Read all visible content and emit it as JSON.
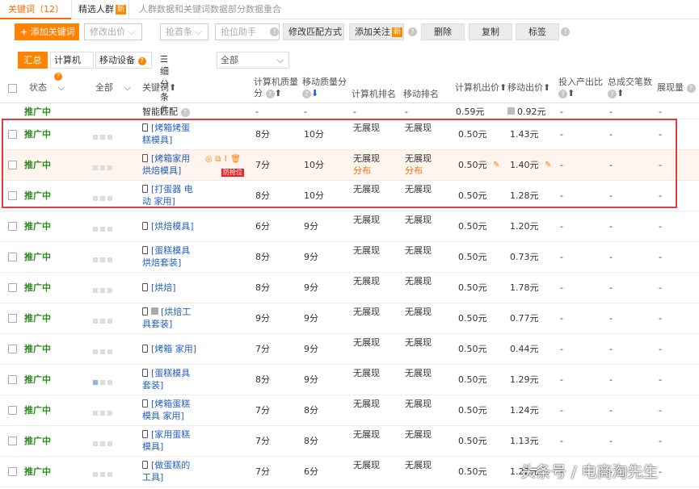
{
  "tabs": {
    "keyword_tab": "关键词",
    "keyword_count": "（12）",
    "crowd_tab": "精选人群",
    "new_badge": "新",
    "note": "人群数据和关键词数据部分数据重合"
  },
  "toolbar": {
    "add_keyword": "添加关键词",
    "change_bid": "修改出价",
    "grab_first": "抢首条",
    "rank_helper": "抢位助手",
    "change_match": "修改匹配方式",
    "add_follow": "添加关注",
    "delete": "删除",
    "copy": "复制",
    "tag": "标签"
  },
  "filters": {
    "summary": "汇总",
    "computer": "计算机",
    "mobile": "移动设备",
    "detail_label": "细分条件:",
    "detail_value": "全部"
  },
  "headers": {
    "status": "状态",
    "all": "全部",
    "keyword": "关键词",
    "pc_quality": "计算机质量分",
    "mobile_quality": "移动质量分",
    "pc_rank": "计算机排名",
    "mobile_rank": "移动排名",
    "pc_bid": "计算机出价",
    "mobile_bid": "移动出价",
    "roi": "投入产出比",
    "total_orders": "总成交笔数",
    "impressions": "展现量"
  },
  "smart_match": {
    "status": "推广中",
    "label": "智能匹配",
    "pc_quality": "-",
    "mobile_quality": "-",
    "pc_rank": "-",
    "mobile_rank": "-",
    "pc_bid": "0.59元",
    "mobile_bid": "0.92元",
    "roi": "-",
    "orders": "-",
    "impressions": "-"
  },
  "rows": [
    {
      "status": "推广中",
      "kw1": "[烤箱烤蛋",
      "kw2": "糕模具]",
      "pcq": "8分",
      "mq": "10分",
      "pcr": "无展现",
      "mr": "无展现",
      "pcb": "0.50元",
      "mb": "1.43元",
      "roi": "-",
      "ord": "-",
      "imp": "-"
    },
    {
      "status": "推广中",
      "kw1": "[烤箱家用",
      "kw2": "烘焙模具]",
      "pcq": "7分",
      "mq": "10分",
      "pcr": "无展现",
      "pcr2": "分布",
      "mr": "无展现",
      "mr2": "分布",
      "pcb": "0.50元",
      "mb": "1.40元",
      "roi": "-",
      "ord": "-",
      "imp": "-",
      "badge": "防抢位"
    },
    {
      "status": "推广中",
      "kw1": "[打蛋器 电",
      "kw2": "动 家用]",
      "pcq": "8分",
      "mq": "10分",
      "pcr": "无展现",
      "mr": "无展现",
      "pcb": "0.50元",
      "mb": "1.28元",
      "roi": "-",
      "ord": "-",
      "imp": "-"
    },
    {
      "status": "推广中",
      "kw1": "[烘焙模具]",
      "kw2": "",
      "pcq": "6分",
      "mq": "9分",
      "pcr": "无展现",
      "mr": "无展现",
      "pcb": "0.50元",
      "mb": "1.20元",
      "roi": "-",
      "ord": "-",
      "imp": "-"
    },
    {
      "status": "推广中",
      "kw1": "[蛋糕模具",
      "kw2": "烘焙套装]",
      "pcq": "8分",
      "mq": "9分",
      "pcr": "无展现",
      "mr": "无展现",
      "pcb": "0.50元",
      "mb": "0.73元",
      "roi": "-",
      "ord": "-",
      "imp": "-"
    },
    {
      "status": "推广中",
      "kw1": "[烘焙]",
      "kw2": "",
      "pcq": "8分",
      "mq": "9分",
      "pcr": "无展现",
      "mr": "无展现",
      "pcb": "0.50元",
      "mb": "1.78元",
      "roi": "-",
      "ord": "-",
      "imp": "-"
    },
    {
      "status": "推广中",
      "kw1": "[烘焙工",
      "kw2": "具套装]",
      "pcq": "9分",
      "mq": "9分",
      "pcr": "无展现",
      "mr": "无展现",
      "pcb": "0.50元",
      "mb": "0.77元",
      "roi": "-",
      "ord": "-",
      "imp": "-"
    },
    {
      "status": "推广中",
      "kw1": "[烤箱 家用]",
      "kw2": "",
      "pcq": "7分",
      "mq": "9分",
      "pcr": "无展现",
      "mr": "无展现",
      "pcb": "0.50元",
      "mb": "0.44元",
      "roi": "-",
      "ord": "-",
      "imp": "-"
    },
    {
      "status": "推广中",
      "kw1": "[蛋糕模具",
      "kw2": "套装]",
      "pcq": "8分",
      "mq": "9分",
      "pcr": "无展现",
      "mr": "无展现",
      "pcb": "0.50元",
      "mb": "1.29元",
      "roi": "-",
      "ord": "-",
      "imp": "-"
    },
    {
      "status": "推广中",
      "kw1": "[烤箱蛋糕",
      "kw2": "模具 家用]",
      "pcq": "7分",
      "mq": "8分",
      "pcr": "无展现",
      "mr": "无展现",
      "pcb": "0.50元",
      "mb": "1.24元",
      "roi": "-",
      "ord": "-",
      "imp": "-"
    },
    {
      "status": "推广中",
      "kw1": "[家用蛋糕",
      "kw2": "模具]",
      "pcq": "7分",
      "mq": "8分",
      "pcr": "无展现",
      "mr": "无展现",
      "pcb": "0.50元",
      "mb": "1.13元",
      "roi": "-",
      "ord": "-",
      "imp": "-"
    },
    {
      "status": "推广中",
      "kw1": "[做蛋糕的",
      "kw2": "工具]",
      "pcq": "7分",
      "mq": "6分",
      "pcr": "无展现",
      "mr": "无展现",
      "pcb": "0.50元",
      "mb": "1.22元",
      "roi": "-",
      "ord": "-",
      "imp": "-"
    }
  ],
  "watermark": "头条号 / 电商淘先生",
  "colors": {
    "accent": "#ff8200",
    "status_green": "#2d8a1e",
    "link_blue": "#2460c8",
    "highlight_red": "#e03c3c"
  }
}
